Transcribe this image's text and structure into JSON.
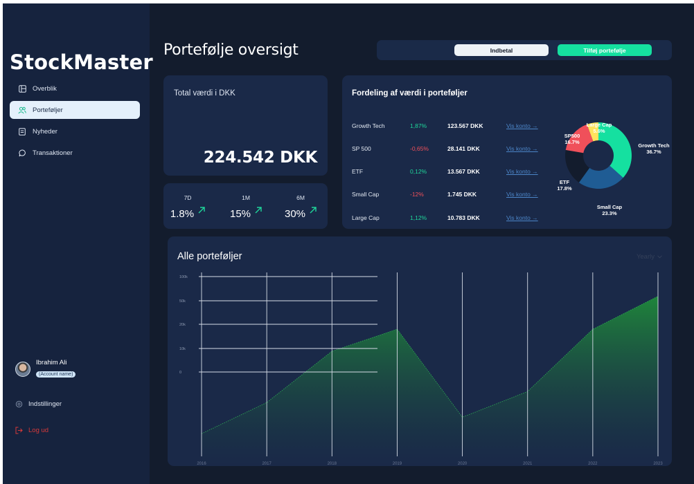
{
  "brand": "StockMaster",
  "nav": [
    {
      "label": "Overblik",
      "icon": "dashboard-icon",
      "active": false
    },
    {
      "label": "Porteføljer",
      "icon": "users-icon",
      "active": true
    },
    {
      "label": "Nyheder",
      "icon": "document-icon",
      "active": false
    },
    {
      "label": "Transaktioner",
      "icon": "chat-bubble-icon",
      "active": false
    }
  ],
  "user": {
    "name": "Ibrahim Ali",
    "role": "(Account name)"
  },
  "settings_label": "Indstillinger",
  "logout_label": "Log ud",
  "header": {
    "title": "Portefølje oversigt",
    "deposit_label": "Indbetal",
    "add_label": "Tilføj portefølje"
  },
  "total": {
    "label": "Total værdi i DKK",
    "value": "224.542 DKK"
  },
  "performance": [
    {
      "label": "7D",
      "value": "1.8%",
      "direction": "up"
    },
    {
      "label": "1M",
      "value": "15%",
      "direction": "up"
    },
    {
      "label": "6M",
      "value": "30%",
      "direction": "up"
    }
  ],
  "distribution": {
    "title": "Fordeling af værdi i porteføljer",
    "link_label": "Vis konto →",
    "rows": [
      {
        "name": "Growth Tech",
        "change": "1,87%",
        "positive": true,
        "amount": "123.567 DKK"
      },
      {
        "name": "SP 500",
        "change": "-0,65%",
        "positive": false,
        "amount": "28.141 DKK"
      },
      {
        "name": "ETF",
        "change": "0,12%",
        "positive": true,
        "amount": "13.567 DKK"
      },
      {
        "name": "Small Cap",
        "change": "-12%",
        "positive": false,
        "amount": "1.745 DKK"
      },
      {
        "name": "Large Cap",
        "change": "1,12%",
        "positive": true,
        "amount": "10.783 DKK"
      }
    ]
  },
  "all_portfolios": {
    "title": "Alle porteføljer",
    "period_label": "Yearly"
  },
  "colors": {
    "accent": "#15e0a0",
    "positive": "#1fd69a",
    "negative": "#f0505a",
    "growth_tech": "#15e0a0",
    "small_cap": "#1f5c94",
    "etf": "#131c2d",
    "sp500": "#f0505a",
    "large_cap": "#ffe25c"
  },
  "chart_data": [
    {
      "type": "pie",
      "title": "",
      "donut": true,
      "slices": [
        {
          "label": "Growth Tech",
          "value": 36.7,
          "display": "36.7%"
        },
        {
          "label": "Small Cap",
          "value": 23.3,
          "display": "23.3%"
        },
        {
          "label": "ETF",
          "value": 17.8,
          "display": "17.8%"
        },
        {
          "label": "SP500",
          "value": 16.7,
          "display": "16.7%"
        },
        {
          "label": "Large Cap",
          "value": 5.6,
          "display": "5.6%"
        }
      ]
    },
    {
      "type": "area",
      "title": "Alle porteføljer",
      "x": [
        "2016",
        "2017",
        "2018",
        "2019",
        "2020",
        "2021",
        "2022",
        "2023"
      ],
      "series": [
        {
          "values": [
            -3.5,
            -1.8,
            1.0,
            2.2,
            -2.6,
            -1.2,
            2.2,
            4.0
          ]
        }
      ],
      "y_ticks": [
        "100k",
        "50k",
        "20k",
        "10k",
        "0"
      ],
      "grid": true
    }
  ]
}
